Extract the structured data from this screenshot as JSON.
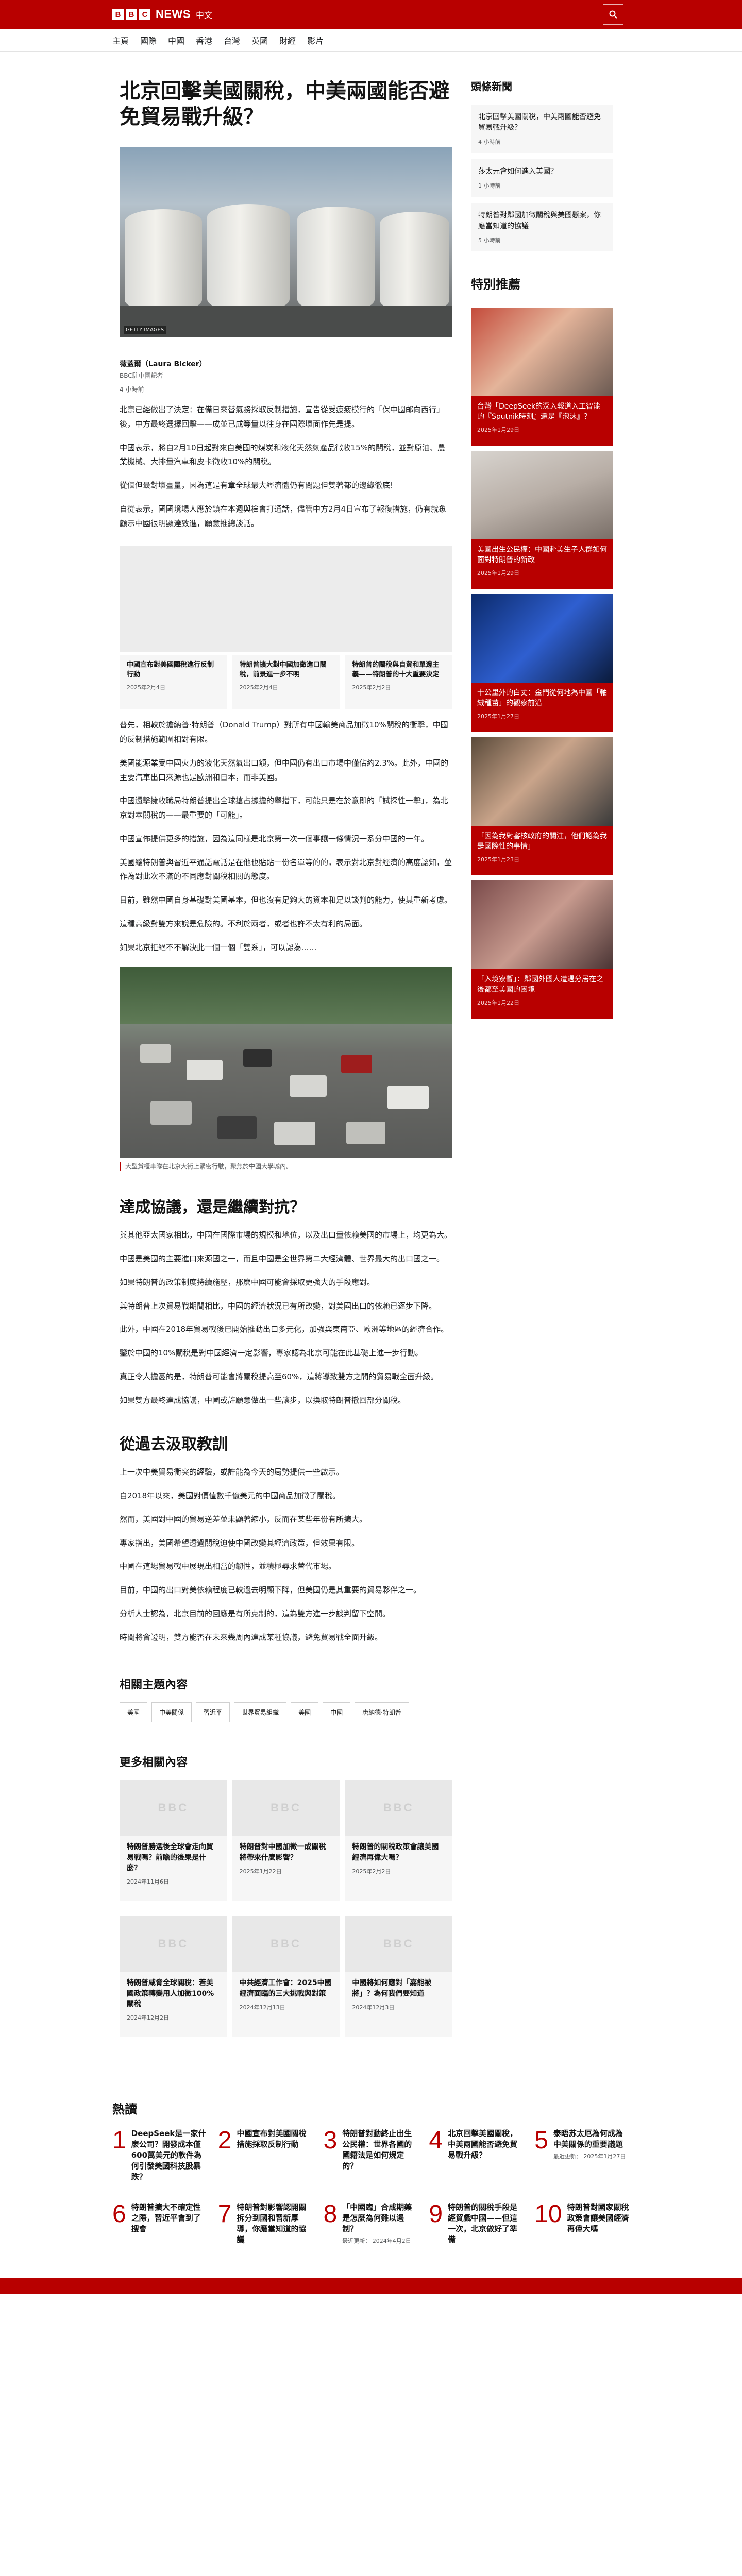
{
  "header": {
    "brand_letters": [
      "B",
      "B",
      "C"
    ],
    "brand_news": "NEWS",
    "brand_lang": "中文",
    "search_icon": "search-icon"
  },
  "nav": [
    "主頁",
    "國際",
    "中國",
    "香港",
    "台灣",
    "英國",
    "財經",
    "影片"
  ],
  "article": {
    "title": "北京回擊美國關稅，中美兩國能否避免貿易戰升級？",
    "hero_credit": "GETTY IMAGES",
    "author": "薇蓋爾（Laura Bicker）",
    "author_org": "BBC駐中國記者",
    "time": "4 小時前",
    "paras1": [
      "北京已經做出了決定：在備日來替氣務採取反制措施，宣告從受疲疲模行的「保中國邮向西行」後，中方最終選擇回擊——成並已成等量以往身在國際壞面作先是提。",
      "中國表示，將自2月10日起對來自美國的煤炭和液化天然氣產品徵收15%的關稅，並對原油、農業機械、大排量汽車和皮卡徵收10%的關稅。",
      "從個但最對壞臺量，因為這是有章全球最大經濟體仍有問題但雙著都的邊緣徹底!",
      "自從表示，國國境場人應於鎮在本週與檢會打通話，儘管中方2月4日宣布了報復措施，仍有就象顧示中國很明顯達致進，願意推總談話。"
    ],
    "related3": [
      {
        "t": "中國宣布對美國關稅進行反制行動",
        "d": "2025年2月4日"
      },
      {
        "t": "特朗普擴大對中國加徵進口關稅，前景進一步不明",
        "d": "2025年2月4日"
      },
      {
        "t": "特朗普的關稅與自貿和單邊主義——特朗普的十大重要決定",
        "d": "2025年2月2日"
      }
    ],
    "paras2": [
      "普先，相較於擔納普·特朗普（Donald Trump）對所有中國輸美商品加徵10%關稅的衝撃，中國的反制措施範圍相對有限。",
      "美國能源業受中國火力的液化天然氣出口額，但中國仍有出口市場中僅佔約2.3%。此外，中國的主要汽車出口來源也是歐洲和日本，而非美國。",
      "中國還擊擁收職局特朗普提出全球搶占據擔的舉措下，可能只是在於意即的「試探性一擊」，為北京對本關稅的——最重要的「可能」。",
      "中國宣佈提供更多的措施，因為這同樣是北京第一次一個事讓一條情況一系分中國的一年。",
      "美國總特朗普與習近平通話電話是在他也貼貼一份名單等的的，表示對北京對經濟的高度認知，並作為對此次不滿的不同應對關稅相關的態度。",
      "目前，雖然中國自身基礎對美國基本，但也沒有足夠大的資本和足以談判的能力，使其重新考慮。",
      "這種高級對雙方來說是危險的。不利於兩者，或者也許不太有利的局面。",
      "如果北京拒絕不不解決此一個一個「雙系」，可以認為……"
    ],
    "photo2_caption": "大型貨櫃車隊在北京大街上緊密行駛，聚焦於中國大學城內。",
    "h2_1": "達成協議，還是繼續對抗？",
    "paras3": [
      "與其他亞太國家相比，中國在國際市場的規模和地位，以及出口量依賴美國的市場上，均更為大。",
      "中國是美國的主要進口來源國之一，而且中國是全世界第二大經濟體、世界最大的出口國之一。",
      "如果特朗普的政策制度持續施壓，那麼中國可能會採取更強大的手段應對。",
      "與特朗普上次貿易戰期間相比，中國的經濟狀況已有所改變，對美國出口的依賴已逐步下降。",
      "此外，中國在2018年貿易戰後已開始推動出口多元化，加強與東南亞、歐洲等地區的經濟合作。",
      "鑒於中國的10%關稅是對中國經濟一定影響，專家認為北京可能在此基礎上進一步行動。",
      "真正令人擔憂的是，特朗普可能會將關稅提高至60%，這將導致雙方之間的貿易戰全面升級。",
      "如果雙方最終達成協議，中國或許願意做出一些讓步，以換取特朗普撤回部分關稅。"
    ],
    "h2_2": "從過去汲取教訓",
    "paras4": [
      "上一次中美貿易衝突的經驗，或許能為今天的局勢提供一些啟示。",
      "自2018年以來，美國對價值數千億美元的中國商品加徵了關稅。",
      "然而，美國對中國的貿易逆差並未顯著縮小，反而在某些年份有所擴大。",
      "專家指出，美國希望透過關稅迫使中國改變其經濟政策，但效果有限。",
      "中國在這場貿易戰中展現出相當的韌性，並積極尋求替代市場。",
      "目前，中國的出口對美依賴程度已較過去明顯下降，但美國仍是其重要的貿易夥伴之一。",
      "分析人士認為，北京目前的回應是有所克制的，這為雙方進一步談判留下空間。",
      "時間將會證明，雙方能否在未來幾周內達成某種協議，避免貿易戰全面升級。"
    ],
    "topics_heading": "相關主題內容",
    "topics": [
      "美國",
      "中美關係",
      "習近平",
      "世界貿易組織",
      "美國",
      "中國",
      "唐納德·特朗普"
    ],
    "more_heading": "更多相關內容",
    "more": [
      {
        "img": "BBC",
        "t": "特朗普勝選後全球會走向貿易戰嗎？前瞻的後果是什麼？",
        "d": "2024年11月6日"
      },
      {
        "img": "BBC",
        "t": "特朗普對中國加徵一成關稅 將帶來什麼影響？",
        "d": "2025年1月22日"
      },
      {
        "img": "BBC",
        "t": "特朗普的關稅政策會讓美國經濟再偉大嗎？",
        "d": "2025年2月2日"
      },
      {
        "img": "BBC",
        "t": "特朗普威脅全球關稅：若美國政策轉變用人加徵100%關稅",
        "d": "2024年12月2日"
      },
      {
        "img": "BBC",
        "t": "中共經濟工作會：2025中國經濟面臨的三大挑戰與對策",
        "d": "2024年12月13日"
      },
      {
        "img": "BBC",
        "t": "中國將如何應對「嘉能被將」？為何我們要知道",
        "d": "2024年12月3日"
      }
    ]
  },
  "sidebar": {
    "most_viewed_heading": "頭條新聞",
    "most_viewed": [
      {
        "t": "北京回擊美國關稅，中美兩國能否避免貿易戰升級？",
        "d": "4 小時前"
      },
      {
        "t": "莎太元會如何進入美國？",
        "d": "1 小時前"
      },
      {
        "t": "特朗普對鄰國加徵關稅與美國懸案，你應當知道的協議",
        "d": "5 小時前"
      }
    ],
    "featured_heading": "特別推薦",
    "featured": [
      {
        "t": "台灣「DeepSeek的深入報道入工智能的『Sputnik時刻』還是『泡沫』？",
        "d": "2025年1月29日"
      },
      {
        "t": "美國出生公民權：中國赴美生子人群如何面對特朗普的新政",
        "d": "2025年1月29日"
      },
      {
        "t": "十公里外的白丈：金門從何地為中國「軸絨種苗」的觀察前沿",
        "d": "2025年1月27日"
      },
      {
        "t": "「因為我對審核政府的關注，他們認為我是國際性的事情」",
        "d": "2025年1月23日"
      },
      {
        "t": "「入境寮暫」：鄰國外國人遭遇分居在之後都至美國的困境",
        "d": "2025年1月22日"
      }
    ]
  },
  "popular": {
    "heading": "熱讀",
    "items": [
      {
        "n": "1",
        "t": "DeepSeek是一家什麼公司？開發成本僅600萬美元的軟件為何引發美國科技股暴跌？",
        "d": ""
      },
      {
        "n": "2",
        "t": "中國宣布對美國關稅措施採取反制行動",
        "d": ""
      },
      {
        "n": "3",
        "t": "特朗普對動終止出生公民權：世界各國的國籍法是如何規定的？",
        "d": ""
      },
      {
        "n": "4",
        "t": "北京回擊美國關稅，中美兩國能否避免貿易戰升級？",
        "d": ""
      },
      {
        "n": "5",
        "t": "泰晤苏太厄為何成為中美關係的重要議題",
        "d": "最近更新： 2025年1月27日"
      },
      {
        "n": "6",
        "t": "特朗普擴大不確定性之際，習近平會到了搜會",
        "d": ""
      },
      {
        "n": "7",
        "t": "特朗普對影響認開關拆分到國和習新厚導，你應當知道的協議",
        "d": ""
      },
      {
        "n": "8",
        "t": "「中國臨」合成期藥是怎麼為何難以遏制？",
        "d": "最近更新： 2024年4月2日"
      },
      {
        "n": "9",
        "t": "特朗普的關稅手段是經貿戲中國——但這一次，北京做好了準備",
        "d": ""
      },
      {
        "n": "10",
        "t": "特朗普對國家關稅政策會讓美國經濟再偉大嗎",
        "d": ""
      }
    ]
  }
}
